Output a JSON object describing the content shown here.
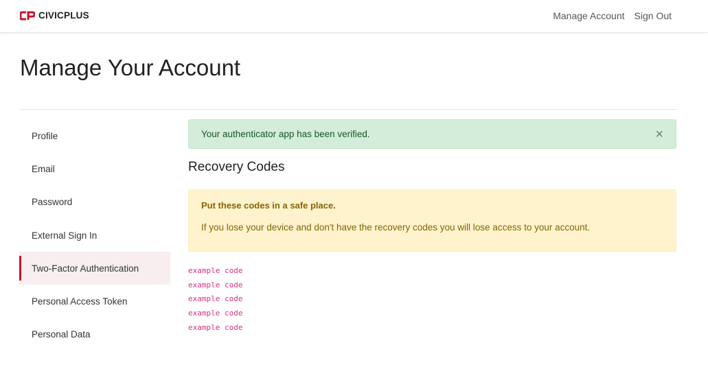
{
  "header": {
    "logo_text": "CIVICPLUS",
    "brand_color": "#c8102e",
    "nav": [
      "Manage Account",
      "Sign Out"
    ]
  },
  "page": {
    "title": "Manage Your Account"
  },
  "sidebar": {
    "items": [
      {
        "label": "Profile",
        "active": false
      },
      {
        "label": "Email",
        "active": false
      },
      {
        "label": "Password",
        "active": false
      },
      {
        "label": "External Sign In",
        "active": false
      },
      {
        "label": "Two-Factor Authentication",
        "active": true
      },
      {
        "label": "Personal Access Token",
        "active": false
      },
      {
        "label": "Personal Data",
        "active": false
      }
    ]
  },
  "main": {
    "success_message": "Your authenticator app has been verified.",
    "close_glyph": "×",
    "section_title": "Recovery Codes",
    "warning_title": "Put these codes in a safe place.",
    "warning_text": "If you lose your device and don't have the recovery codes you will lose access to your account.",
    "codes": [
      "example code",
      "example code",
      "example code",
      "example code",
      "example code"
    ]
  }
}
